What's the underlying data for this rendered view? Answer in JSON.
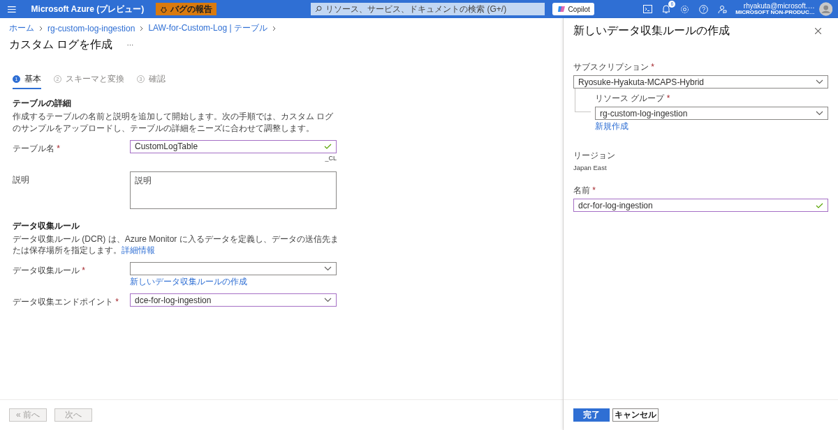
{
  "required_mark": "*",
  "topbar": {
    "brand": "Microsoft Azure (プレビュー)",
    "bug_button": "バグの報告",
    "search": {
      "placeholder": "リソース、サービス、ドキュメントの検索 (G+/)"
    },
    "copilot_button": "Copilot",
    "notification_count": "6",
    "account": {
      "email": "rhyakuta@microsoft.…",
      "tenant": "MICROSOFT NON-PRODUC…"
    }
  },
  "breadcrumb": [
    "ホーム",
    "rg-custom-log-ingestion",
    "LAW-for-Custom-Log | テーブル"
  ],
  "page": {
    "title": "カスタム ログを作成",
    "more": "···"
  },
  "steps": [
    {
      "number": "1",
      "label": "基本",
      "selected": true
    },
    {
      "number": "2",
      "label": "スキーマと変換",
      "selected": false
    },
    {
      "number": "3",
      "label": "確認",
      "selected": false
    }
  ],
  "sections": [
    {
      "heading": "テーブルの詳細",
      "description": "作成するテーブルの名前と説明を追加して開始します。次の手順では、カスタム ログのサンプルをアップロードし、テーブルの詳細をニーズに合わせて調整します。",
      "fields": [
        {
          "kind": "text",
          "label": "テーブル名",
          "required": true,
          "value": "CustomLogTable",
          "valid": true,
          "modified": true,
          "suffix": "_CL"
        },
        {
          "kind": "textarea",
          "label": "説明",
          "required": false,
          "placeholder": "説明",
          "modified": false
        }
      ]
    },
    {
      "heading": "データ収集ルール",
      "description": "データ収集ルール (DCR) は、Azure Monitor に入るデータを定義し、データの送信先または保存場所を指定します。",
      "link": "詳細情報",
      "fields": [
        {
          "kind": "select",
          "label": "データ収集ルール",
          "required": true,
          "valid": false,
          "modified": false,
          "link": "新しいデータ収集ルールの作成"
        },
        {
          "kind": "select",
          "label": "データ収集エンドポイント",
          "required": true,
          "value": "dce-for-log-ingestion",
          "valid": false,
          "modified": true
        }
      ]
    }
  ],
  "footer_buttons": [
    {
      "label": "« 前へ",
      "disabled": true
    },
    {
      "label": "次へ",
      "disabled": true
    }
  ],
  "panel": {
    "title": "新しいデータ収集ルールの作成",
    "subscription": {
      "label": "サブスクリプション",
      "required": true,
      "value": "Ryosuke-Hyakuta-MCAPS-Hybrid"
    },
    "resource_group": {
      "label": "リソース グループ",
      "required": true,
      "value": "rg-custom-log-ingestion",
      "link": "新規作成"
    },
    "region": {
      "label": "リージョン",
      "value": "Japan East"
    },
    "name": {
      "label": "名前",
      "required": true,
      "value": "dcr-for-log-ingestion",
      "valid": true,
      "modified": true
    },
    "buttons": [
      {
        "label": "完了",
        "kind": "primary"
      },
      {
        "label": "キャンセル",
        "kind": "secondary"
      }
    ]
  }
}
